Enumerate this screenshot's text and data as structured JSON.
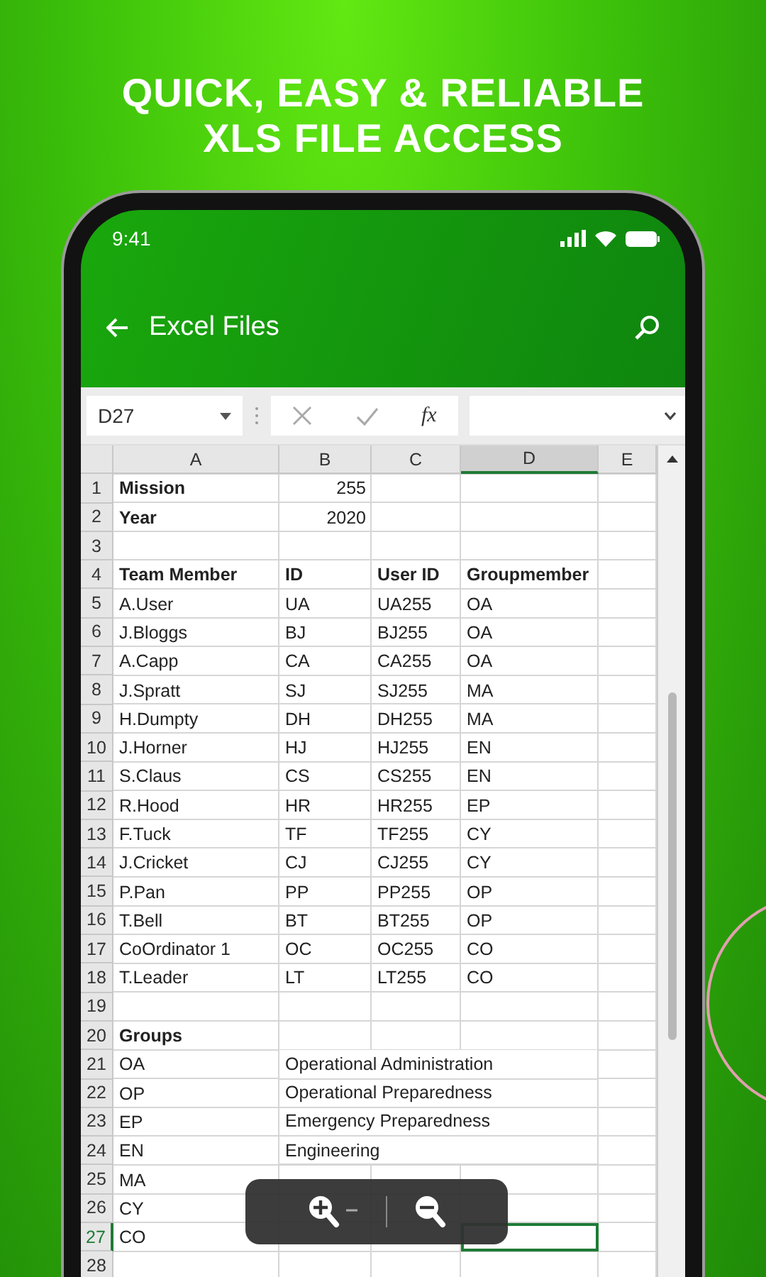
{
  "headline": [
    "QUICK, EASY & RELIABLE",
    "XLS FILE ACCESS"
  ],
  "status_bar": {
    "time": "9:41"
  },
  "app_bar": {
    "title": "Excel Files"
  },
  "formula_bar": {
    "cell_ref": "D27",
    "function_label": "fx"
  },
  "columns": [
    {
      "label": "A",
      "selected": false
    },
    {
      "label": "B",
      "selected": false
    },
    {
      "label": "C",
      "selected": false
    },
    {
      "label": "D",
      "selected": true
    },
    {
      "label": "E",
      "selected": false
    }
  ],
  "rows": [
    {
      "number": "1",
      "selected": false,
      "a": {
        "text": "Mission",
        "bold": true
      },
      "b": {
        "text": "255",
        "kind": "number"
      }
    },
    {
      "number": "2",
      "selected": false,
      "a": {
        "text": "Year",
        "bold": true
      },
      "b": {
        "text": "2020",
        "kind": "number"
      }
    },
    {
      "number": "3",
      "selected": false
    },
    {
      "number": "4",
      "selected": false,
      "a": {
        "text": "Team Member",
        "bold": true
      },
      "b": {
        "text": "ID",
        "bold": true
      },
      "c": {
        "text": "User ID",
        "bold": true
      },
      "d": {
        "text": "Groupmember",
        "bold": true
      }
    },
    {
      "number": "5",
      "selected": false,
      "a": {
        "text": "A.User"
      },
      "b": {
        "text": "UA"
      },
      "c": {
        "text": "UA255"
      },
      "d": {
        "text": "OA"
      }
    },
    {
      "number": "6",
      "selected": false,
      "a": {
        "text": "J.Bloggs"
      },
      "b": {
        "text": "BJ"
      },
      "c": {
        "text": "BJ255"
      },
      "d": {
        "text": "OA"
      }
    },
    {
      "number": "7",
      "selected": false,
      "a": {
        "text": "A.Capp"
      },
      "b": {
        "text": "CA"
      },
      "c": {
        "text": "CA255"
      },
      "d": {
        "text": "OA"
      }
    },
    {
      "number": "8",
      "selected": false,
      "a": {
        "text": "J.Spratt"
      },
      "b": {
        "text": "SJ"
      },
      "c": {
        "text": "SJ255"
      },
      "d": {
        "text": "MA"
      }
    },
    {
      "number": "9",
      "selected": false,
      "a": {
        "text": "H.Dumpty"
      },
      "b": {
        "text": "DH"
      },
      "c": {
        "text": "DH255"
      },
      "d": {
        "text": "MA"
      }
    },
    {
      "number": "10",
      "selected": false,
      "a": {
        "text": "J.Horner"
      },
      "b": {
        "text": "HJ"
      },
      "c": {
        "text": "HJ255"
      },
      "d": {
        "text": "EN"
      }
    },
    {
      "number": "11",
      "selected": false,
      "a": {
        "text": "S.Claus"
      },
      "b": {
        "text": "CS"
      },
      "c": {
        "text": "CS255"
      },
      "d": {
        "text": "EN"
      }
    },
    {
      "number": "12",
      "selected": false,
      "a": {
        "text": "R.Hood"
      },
      "b": {
        "text": "HR"
      },
      "c": {
        "text": "HR255"
      },
      "d": {
        "text": "EP"
      }
    },
    {
      "number": "13",
      "selected": false,
      "a": {
        "text": "F.Tuck"
      },
      "b": {
        "text": "TF"
      },
      "c": {
        "text": "TF255"
      },
      "d": {
        "text": "CY"
      }
    },
    {
      "number": "14",
      "selected": false,
      "a": {
        "text": "J.Cricket"
      },
      "b": {
        "text": "CJ"
      },
      "c": {
        "text": "CJ255"
      },
      "d": {
        "text": "CY"
      }
    },
    {
      "number": "15",
      "selected": false,
      "a": {
        "text": "P.Pan"
      },
      "b": {
        "text": "PP"
      },
      "c": {
        "text": "PP255"
      },
      "d": {
        "text": "OP"
      }
    },
    {
      "number": "16",
      "selected": false,
      "a": {
        "text": "T.Bell"
      },
      "b": {
        "text": "BT"
      },
      "c": {
        "text": "BT255"
      },
      "d": {
        "text": "OP"
      }
    },
    {
      "number": "17",
      "selected": false,
      "a": {
        "text": "CoOrdinator 1"
      },
      "b": {
        "text": "OC"
      },
      "c": {
        "text": "OC255"
      },
      "d": {
        "text": "CO"
      }
    },
    {
      "number": "18",
      "selected": false,
      "a": {
        "text": "T.Leader"
      },
      "b": {
        "text": "LT"
      },
      "c": {
        "text": "LT255"
      },
      "d": {
        "text": "CO"
      }
    },
    {
      "number": "19",
      "selected": false
    },
    {
      "number": "20",
      "selected": false,
      "a": {
        "text": "Groups",
        "bold": true
      }
    },
    {
      "number": "21",
      "selected": false,
      "a": {
        "text": "OA"
      },
      "b": {
        "text": "Operational Administration"
      }
    },
    {
      "number": "22",
      "selected": false,
      "a": {
        "text": "OP"
      },
      "b": {
        "text": "Operational Preparedness"
      }
    },
    {
      "number": "23",
      "selected": false,
      "a": {
        "text": "EP"
      },
      "b": {
        "text": "Emergency Preparedness"
      }
    },
    {
      "number": "24",
      "selected": false,
      "a": {
        "text": "EN"
      },
      "b": {
        "text": "Engineering"
      }
    },
    {
      "number": "25",
      "selected": false,
      "a": {
        "text": "MA"
      }
    },
    {
      "number": "26",
      "selected": false,
      "a": {
        "text": "CY"
      }
    },
    {
      "number": "27",
      "selected": true,
      "a": {
        "text": "CO"
      },
      "d": {
        "selected": true
      }
    },
    {
      "number": "28",
      "selected": false
    }
  ]
}
